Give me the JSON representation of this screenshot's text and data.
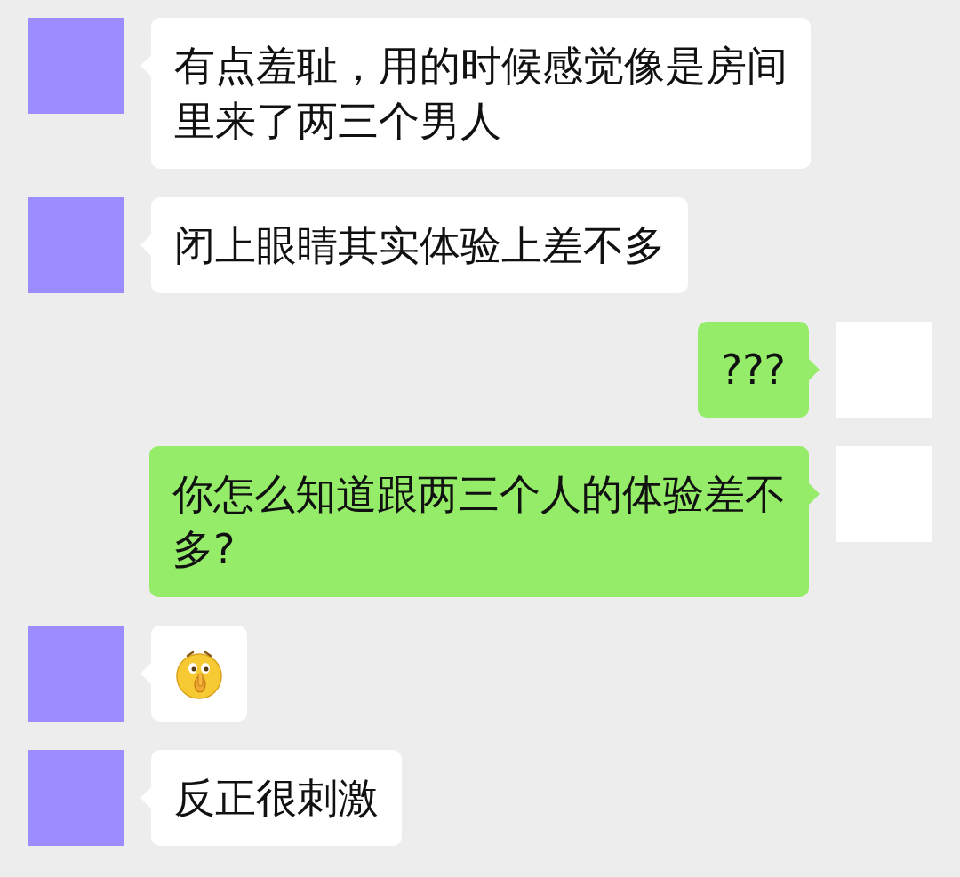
{
  "messages": [
    {
      "outgoing": false,
      "kind": "text",
      "text": "有点羞耻，用的时候感觉像是房间里来了两三个男人"
    },
    {
      "outgoing": false,
      "kind": "text",
      "text": "闭上眼睛其实体验上差不多"
    },
    {
      "outgoing": true,
      "kind": "text",
      "text": "???"
    },
    {
      "outgoing": true,
      "kind": "text",
      "text": "你怎么知道跟两三个人的体验差不多?"
    },
    {
      "outgoing": false,
      "kind": "emoji"
    },
    {
      "outgoing": false,
      "kind": "text",
      "text": "反正很刺激"
    }
  ]
}
